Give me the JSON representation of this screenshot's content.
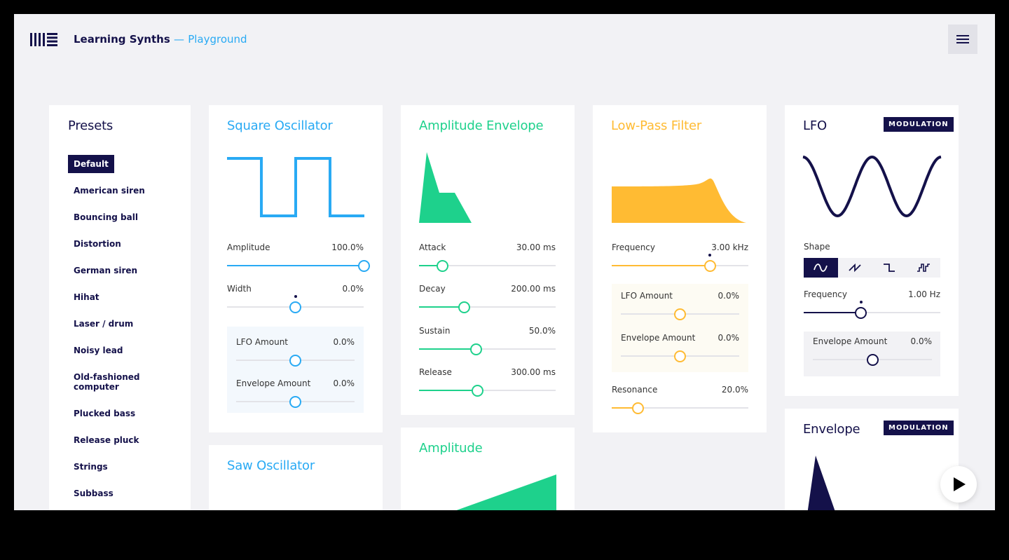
{
  "header": {
    "app_name": "Learning Synths",
    "separator": "—",
    "section": "Playground",
    "menu_icon": "hamburger-icon",
    "logo_icon": "ableton-logo"
  },
  "colors": {
    "navy": "#14114a",
    "blue": "#29aaf4",
    "green": "#1ed18c",
    "yellow": "#ffbb33",
    "background": "#f2f2f5"
  },
  "presets": {
    "title": "Presets",
    "items": [
      "Default",
      "American siren",
      "Bouncing ball",
      "Distortion",
      "German siren",
      "Hihat",
      "Laser / drum",
      "Noisy lead",
      "Old-fashioned computer",
      "Plucked bass",
      "Release pluck",
      "Strings",
      "Subbass"
    ],
    "selected": "Default"
  },
  "square_osc": {
    "title": "Square Oscillator",
    "params": [
      {
        "label": "Amplitude",
        "value": "100.0%",
        "pos": 1.0
      },
      {
        "label": "Width",
        "value": "0.0%",
        "pos": 0.5
      },
      {
        "label": "LFO Amount",
        "value": "0.0%",
        "pos": 0.5
      },
      {
        "label": "Envelope Amount",
        "value": "0.0%",
        "pos": 0.5
      }
    ]
  },
  "saw_osc": {
    "title": "Saw Oscillator"
  },
  "amp_env": {
    "title": "Amplitude Envelope",
    "params": [
      {
        "label": "Attack",
        "value": "30.00 ms",
        "pos": 0.17
      },
      {
        "label": "Decay",
        "value": "200.00 ms",
        "pos": 0.33
      },
      {
        "label": "Sustain",
        "value": "50.0%",
        "pos": 0.42
      },
      {
        "label": "Release",
        "value": "300.00 ms",
        "pos": 0.43
      }
    ]
  },
  "amplitude": {
    "title": "Amplitude"
  },
  "lpf": {
    "title": "Low-Pass Filter",
    "params": [
      {
        "label": "Frequency",
        "value": "3.00 kHz",
        "pos": 0.72
      },
      {
        "label": "LFO Amount",
        "value": "0.0%",
        "pos": 0.5
      },
      {
        "label": "Envelope Amount",
        "value": "0.0%",
        "pos": 0.5
      },
      {
        "label": "Resonance",
        "value": "20.0%",
        "pos": 0.19
      }
    ]
  },
  "lfo": {
    "title": "LFO",
    "badge": "MODULATION",
    "shape_label": "Shape",
    "shapes": [
      "sine",
      "sawtooth",
      "square",
      "random"
    ],
    "selected_shape": "sine",
    "params": [
      {
        "label": "Frequency",
        "value": "1.00 Hz",
        "pos": 0.42
      },
      {
        "label": "Envelope Amount",
        "value": "0.0%",
        "pos": 0.5
      }
    ]
  },
  "envelope": {
    "title": "Envelope",
    "badge": "MODULATION"
  },
  "play_button": {
    "icon": "play-icon"
  }
}
